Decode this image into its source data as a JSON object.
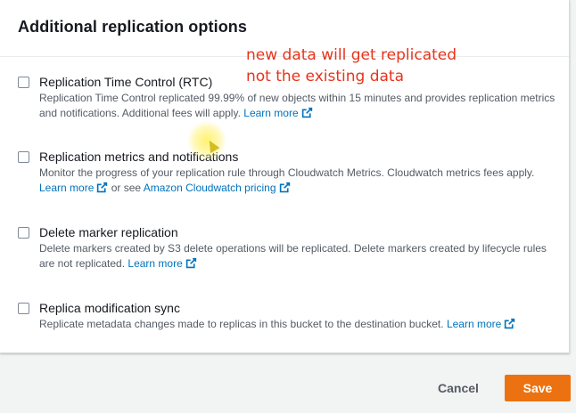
{
  "panel": {
    "title": "Additional replication options"
  },
  "annotation": {
    "line1": "new data will get replicated",
    "line2": "not the existing data"
  },
  "options": [
    {
      "title": "Replication Time Control (RTC)",
      "desc_text": "Replication Time Control replicated 99.99% of new objects within 15 minutes and provides replication metrics and notifications. Additional fees will apply.",
      "link_text": "Learn more",
      "checked": false
    },
    {
      "title": "Replication metrics and notifications",
      "desc_text": "Monitor the progress of your replication rule through Cloudwatch Metrics. Cloudwatch metrics fees apply.",
      "link_text": "Learn more",
      "or_text": "or see",
      "link2_text": "Amazon Cloudwatch pricing",
      "checked": false
    },
    {
      "title": "Delete marker replication",
      "desc_text": "Delete markers created by S3 delete operations will be replicated. Delete markers created by lifecycle rules are not replicated.",
      "link_text": "Learn more",
      "checked": false
    },
    {
      "title": "Replica modification sync",
      "desc_text": "Replicate metadata changes made to replicas in this bucket to the destination bucket.",
      "link_text": "Learn more",
      "checked": false
    }
  ],
  "footer": {
    "cancel_label": "Cancel",
    "save_label": "Save"
  },
  "icons": {
    "external_link": "external-link-icon"
  },
  "colors": {
    "primary_button": "#ec7211",
    "link": "#0073bb",
    "annotation": "#e8331b"
  }
}
